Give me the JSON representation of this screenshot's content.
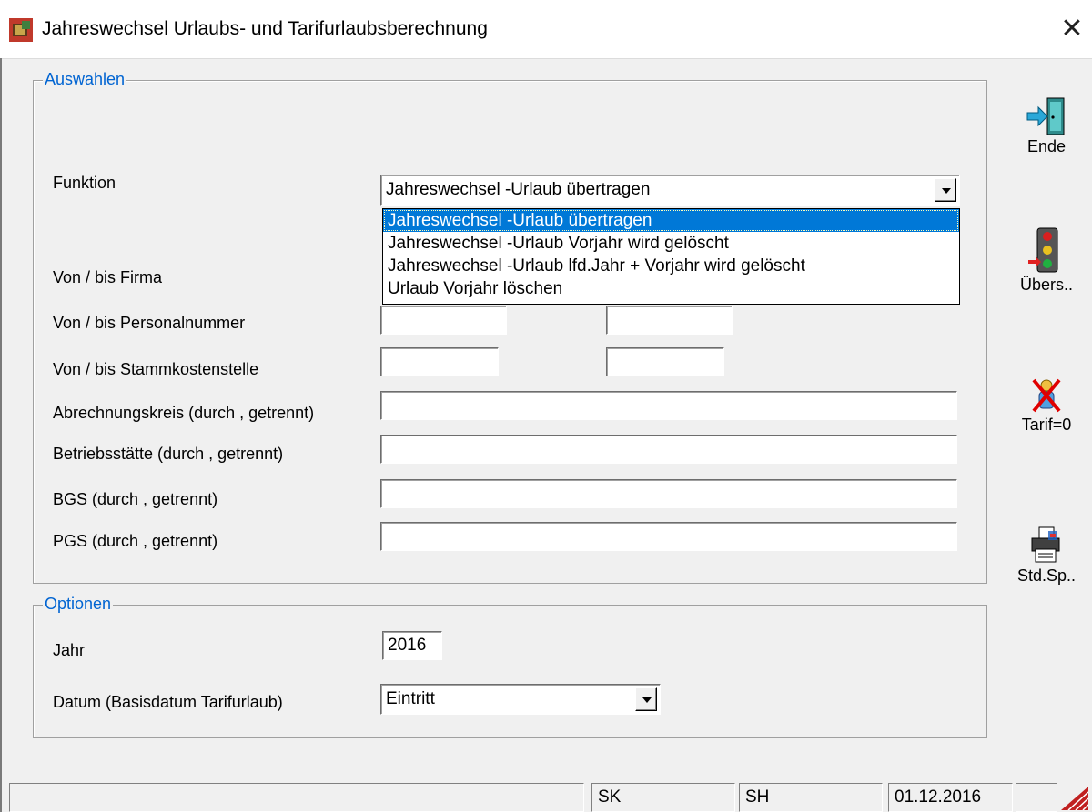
{
  "window": {
    "title": "Jahreswechsel Urlaubs- und Tarifurlaubsberechnung",
    "close_symbol": "✕"
  },
  "auswahlen": {
    "legend": "Auswahlen",
    "funktion": {
      "label": "Funktion",
      "value": "Jahreswechsel -Urlaub übertragen",
      "options": [
        "Jahreswechsel -Urlaub übertragen",
        "Jahreswechsel -Urlaub Vorjahr wird gelöscht",
        "Jahreswechsel -Urlaub lfd.Jahr + Vorjahr wird gelöscht",
        "Urlaub Vorjahr löschen"
      ],
      "selected_index": 0
    },
    "firma": {
      "label": "Von / bis Firma",
      "from": "",
      "to": ""
    },
    "personalnummer": {
      "label": "Von / bis Personalnummer",
      "from": "",
      "to": ""
    },
    "stammkostenstelle": {
      "label": "Von / bis Stammkostenstelle",
      "from": "",
      "to": ""
    },
    "abrechnungskreis": {
      "label": "Abrechnungskreis (durch , getrennt)",
      "value": ""
    },
    "betriebsstaette": {
      "label": "Betriebsstätte (durch , getrennt)",
      "value": ""
    },
    "bgs": {
      "label": "BGS (durch , getrennt)",
      "value": ""
    },
    "pgs": {
      "label": "PGS (durch , getrennt)",
      "value": ""
    }
  },
  "optionen": {
    "legend": "Optionen",
    "jahr": {
      "label": "Jahr",
      "value": "2016"
    },
    "datum": {
      "label": "Datum (Basisdatum Tarifurlaub)",
      "value": "Eintritt"
    }
  },
  "toolbar": {
    "ende": "Ende",
    "uebersicht": "Übers..",
    "tarif": "Tarif=0",
    "std_sp": "Std.Sp.."
  },
  "statusbar": {
    "panels": [
      "",
      "SK",
      "SH",
      "01.12.2016",
      ""
    ]
  },
  "icons": {
    "app": "app-window-icon",
    "ende": "exit-door-icon",
    "uebersicht": "traffic-light-icon",
    "tarif": "person-crossed-icon",
    "std_sp": "printer-icon"
  },
  "colors": {
    "legend": "#0064d2",
    "selection": "#0078d7"
  }
}
